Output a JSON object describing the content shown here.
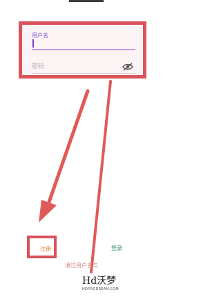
{
  "form": {
    "username_label": "用户名",
    "username_value": "",
    "password_placeholder": "密码"
  },
  "actions": {
    "register_label": "注册",
    "login_label": "登录",
    "bottom_link_label": "通过用户名与"
  },
  "icons": {
    "password_toggle": "eye-off-icon"
  },
  "watermark": {
    "text": "Hd沃梦",
    "subtext": "HDPOODREAM.COM"
  },
  "colors": {
    "annotation_red": "#d9535b",
    "accent_purple": "#8b5bd6",
    "register_orange": "#e07a2e",
    "login_green": "#2f8a5e"
  }
}
